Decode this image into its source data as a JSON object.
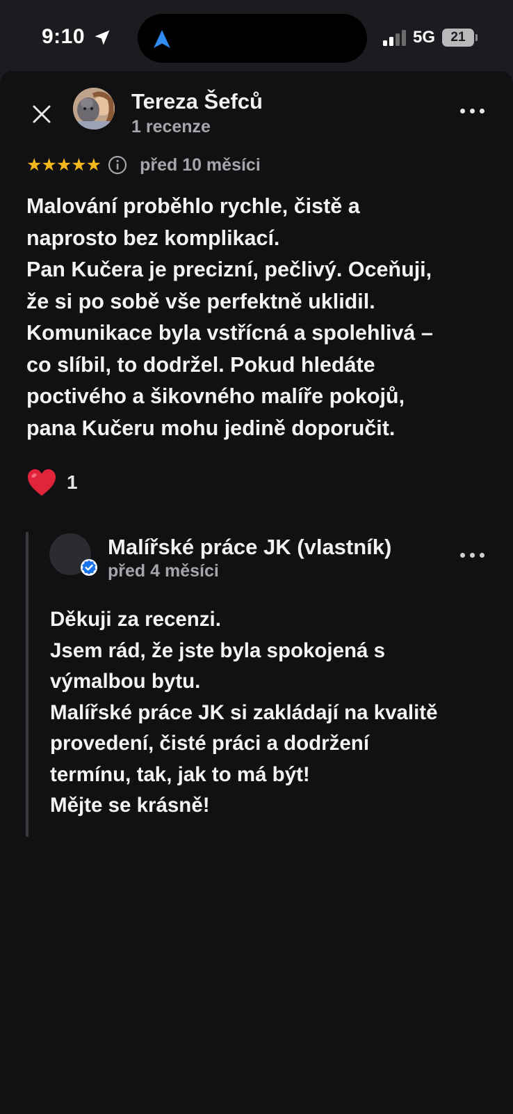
{
  "status_bar": {
    "time": "9:10",
    "network": "5G",
    "battery": "21"
  },
  "review": {
    "reviewer_name": "Tereza Šefců",
    "review_count": "1 recenze",
    "rating": 5,
    "stars": "★★★★★",
    "date": "před 10 měsíci",
    "text_lines": [
      "Malování proběhlo rychle, čistě a",
      "naprosto bez komplikací.",
      "Pan Kučera je precizní, pečlivý. Oceňuji,",
      "že si po sobě vše perfektně uklidil.",
      "Komunikace byla vstřícná a spolehlivá –",
      "co slíbil, to dodržel. Pokud hledáte",
      "poctivého a šikovného malíře pokojů,",
      "pana Kučeru mohu jedině doporučit."
    ],
    "reaction_count": "1"
  },
  "owner_reply": {
    "name": "Malířské práce JK (vlastník)",
    "date": "před 4 měsíci",
    "text_lines": [
      "Děkuji za recenzi.",
      "Jsem rád, že jste byla spokojená s",
      "výmalbou bytu.",
      "Malířské práce JK si zakládají na kvalitě",
      "provedení, čisté práci a dodržení",
      "termínu, tak, jak to má být!",
      "Mějte se krásně!"
    ]
  },
  "colors": {
    "background": "#111113",
    "star": "#f6b71c",
    "heart": "#e0243a",
    "verified": "#1a73e8",
    "secondary_text": "#a6a6aa"
  }
}
